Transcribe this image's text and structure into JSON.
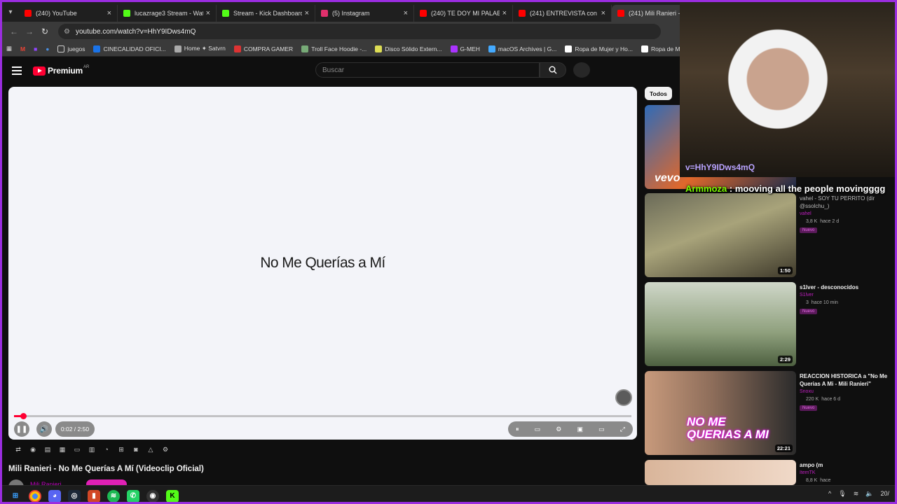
{
  "tabs": [
    {
      "label": "(240) YouTube",
      "color": "#ff0000"
    },
    {
      "label": "lucazrage3 Stream - Watc",
      "color": "#53fc18"
    },
    {
      "label": "Stream - Kick Dashboard",
      "color": "#53fc18"
    },
    {
      "label": "(5) Instagram",
      "color": "#e1306c"
    },
    {
      "label": "(240) TE DOY MI PALABRA",
      "color": "#ff0000"
    },
    {
      "label": "(241) ENTREVISTA con",
      "color": "#ff0000"
    },
    {
      "label": "(241) Mili Ranieri - N",
      "color": "#ff0000"
    }
  ],
  "address": {
    "url": "youtube.com/watch?v=HhY9IDws4mQ"
  },
  "bookmarks": [
    {
      "label": "juegos",
      "color": "#888"
    },
    {
      "label": "CINECALIDAD OFICI...",
      "color": "#1a73e8"
    },
    {
      "label": "Home ✦ Satvrn",
      "color": "#aaa"
    },
    {
      "label": "COMPRA GAMER",
      "color": "#d33"
    },
    {
      "label": "Troll Face Hoodie -...",
      "color": "#7a7"
    },
    {
      "label": "Disco Sólido Extern...",
      "color": "#dd5"
    },
    {
      "label": "G-MEH",
      "color": "#a3f"
    },
    {
      "label": "macOS Archives | G...",
      "color": "#4af"
    },
    {
      "label": "Ropa de Mujer y Ho...",
      "color": "#fff"
    },
    {
      "label": "Ropa de Mujer y H",
      "color": "#fff"
    }
  ],
  "youtube": {
    "brand": "Premium",
    "country": "AR",
    "search_placeholder": "Buscar"
  },
  "player": {
    "overlay_title": "No Me Querías a Mí",
    "time": "0:02 / 2:50",
    "progress_fraction": 0.012
  },
  "video": {
    "title": "Mili Ranieri - No Me Querías A Mí (Videoclip Oficial)",
    "channel": "Mili Ranieri"
  },
  "sidebar": {
    "chip": "Todos",
    "cards": [
      {
        "title": "vahel - SOY TU PERRITO (dir @ssolchu_)",
        "channel": "vahel",
        "views": "3,8 K",
        "age": "hace 2 d",
        "badge": "Nuevo",
        "duration": "1:50"
      },
      {
        "title": "s1lver - desconocidos",
        "channel": "S1lver",
        "views": "3",
        "age": "hace 10 min",
        "badge": "Nuevo",
        "duration": "2:29"
      },
      {
        "title": "REACCION HISTORICA a \"No Me Querias A Mi - Mili Ranieri\"",
        "channel": "Snoxu",
        "views": "220 K",
        "age": "hace 6 d",
        "badge": "Nuevo",
        "duration": "22:21"
      },
      {
        "title": "ampo (m",
        "channel": "ItemTK",
        "views": "8,8 K",
        "age": "hace",
        "badge": "",
        "duration": ""
      }
    ]
  },
  "stream": {
    "url_fragment": "v=HhY9IDws4mQ",
    "chat_user": "Armmoza",
    "chat_msg": "mooving all the people movingggg"
  },
  "taskbar": {
    "clock": "20/"
  }
}
